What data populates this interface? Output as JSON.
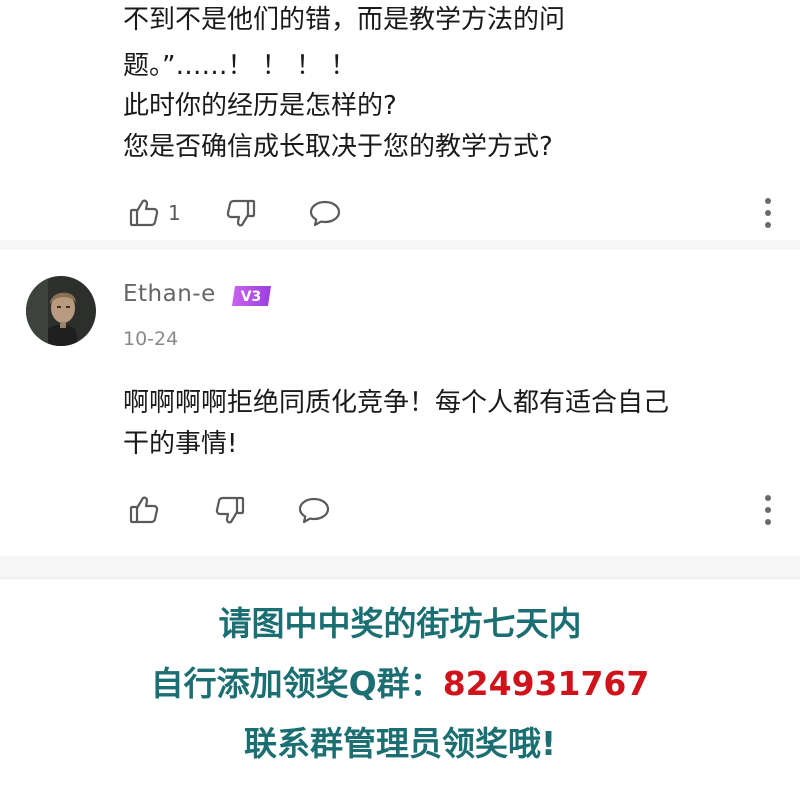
{
  "comment_1": {
    "lines": [
      "不到不是他们的错，而是教学方法的问",
      "题。”……！ ！ ！ ！",
      "此时你的经历是怎样的?",
      "您是否确信成长取决于您的教学方式?"
    ],
    "like_count": "1"
  },
  "comment_2": {
    "username": "Ethan-e",
    "level_badge": "V3",
    "date": "10-24",
    "lines": [
      "啊啊啊啊拒绝同质化竞争！每个人都有适合自己",
      "干的事情!"
    ]
  },
  "promo": {
    "line1": "请图中中奖的街坊七天内",
    "line2_prefix": "自行添加领奖Q群：",
    "line2_number": "824931767",
    "line3": "联系群管理员领奖哦!"
  },
  "colors": {
    "promo_teal": "#1b6f72",
    "promo_red": "#d0121b",
    "badge_purple": "#b44ae0",
    "icon_gray": "#5a5a5a"
  },
  "icons": [
    "thumb-up-icon",
    "thumb-down-icon",
    "comment-bubble-icon",
    "more-vertical-icon"
  ]
}
